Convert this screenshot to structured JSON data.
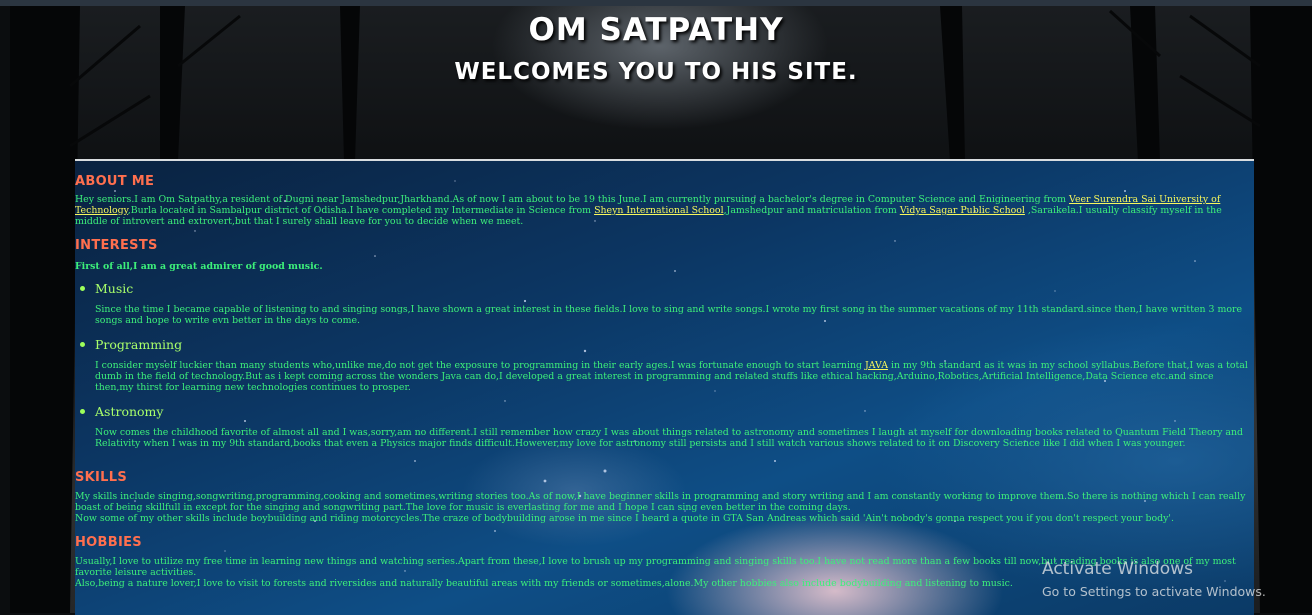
{
  "header": {
    "title": "OM SATPATHY",
    "subtitle": "WELCOMES YOU TO HIS SITE."
  },
  "about": {
    "heading": "ABOUT ME",
    "text1": "Hey seniors.I am Om Satpathy,a resident of Dugni near Jamshedpur,Jharkhand.As of now I am about to be 19 this June.I am currently pursuing a bachelor's degree in Computer Science and Enigineering from ",
    "link1": "Veer Surendra Sai University of Technology",
    "text2": ",Burla located in Sambalpur district of Odisha.I have completed my Intermediate in Science from ",
    "link2": "Sheyn International School",
    "text3": ",Jamshedpur and matriculation from ",
    "link3": "Vidya Sagar Public School",
    "text4": " ,Saraikela.I usually classify myself in the middle of introvert and extrovert,but that I surely shall leave for you to decide when we meet."
  },
  "interests": {
    "heading": "INTERESTS",
    "intro": "First of all,I am a great admirer of good music.",
    "items": [
      {
        "title": "Music",
        "text": "Since the time I became capable of listening to and singing songs,I have shown a great interest in these fields.I love to sing and write songs.I wrote my first song in the summer vacations of my 11th standard.since then,I have written 3 more songs and hope to write evn better in the days to come."
      },
      {
        "title": "Programming",
        "text_before": "I consider myself luckier than many students who,unlike me,do not get the exposure to programming in their early ages.I was fortunate enough to start learning ",
        "link": "JAVA",
        "text_after": " in my 9th standard as it was in my school syllabus.Before that,I was a total dumb in the field of technology.But as i kept coming across the wonders Java can do,I developed a great interest in programming and related stuffs like ethical hacking,Arduino,Robotics,Artificial Intelligence,Data Science etc.and since then,my thirst for learning new technologies continues to prosper."
      },
      {
        "title": "Astronomy",
        "text": "Now comes the childhood favorite of almost all and I was,sorry,am no different.I still remember how crazy I was about things related to astronomy and sometimes I laugh at myself for downloading books related to Quantum Field Theory and Relativity when I was in my 9th standard,books that even a Physics major finds difficult.However,my love for astronomy still persists and I still watch various shows related to it on Discovery Science like I did when I was younger."
      }
    ]
  },
  "skills": {
    "heading": "SKILLS",
    "line1": "My skills include singing,songwriting,programming,cooking and sometimes,writing stories too.As of now,I have beginner skills in programming and story writing and I am constantly working to improve them.So there is nothing which I can really boast of being skillfull in except for the singing and songwriting part.The love for music is everlasting for me and I hope I can sing even better in the coming days.",
    "line2": "Now some of my other skills include boybuilding and riding motorcycles.The craze of bodybuilding arose in me since I heard a quote in GTA San Andreas which said 'Ain't nobody's gonna respect you if you don't respect your body'."
  },
  "hobbies": {
    "heading": "HOBBIES",
    "line1": "Usually,I love to utilize my free time in learning new things and watching series.Apart from these,I love to brush up my programming and singing skills too.I have not read more than a few books till now,but reading books is also one of my most favorite leisure activities.",
    "line2": "Also,being a nature lover,I love to visit to forests and riversides and naturally beautiful areas with my friends or sometimes,alone.My other hobbies also include bodybuilding and listening to music."
  },
  "watermark": {
    "line1": "Activate Windows",
    "line2": "Go to Settings to activate Windows."
  },
  "colors": {
    "heading": "#ff6f4e",
    "body_text": "#3df07a",
    "link": "#f7f75c",
    "item_title": "#a9ff6a"
  }
}
